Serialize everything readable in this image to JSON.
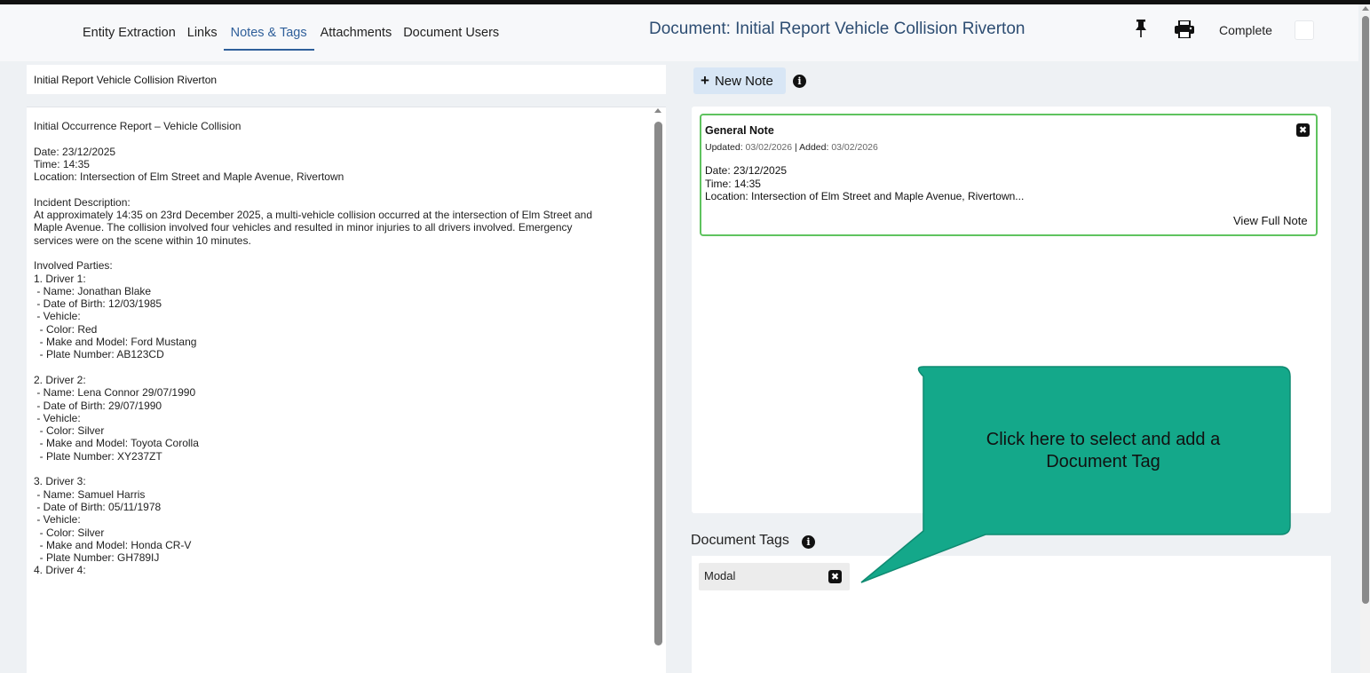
{
  "tabs": [
    {
      "label": "Entity Extraction"
    },
    {
      "label": "Links"
    },
    {
      "label": "Notes & Tags",
      "active": true
    },
    {
      "label": "Attachments"
    },
    {
      "label": "Document Users"
    }
  ],
  "header": {
    "doc_title": "Document: Initial Report Vehicle Collision Riverton",
    "complete_label": "Complete",
    "complete_checked": false,
    "pin_icon": "pin-icon",
    "print_icon": "print-icon"
  },
  "document": {
    "title_value": "Initial Report Vehicle Collision Riverton",
    "body": "Initial Occurrence Report – Vehicle Collision\n\nDate: 23/12/2025\nTime: 14:35\nLocation: Intersection of Elm Street and Maple Avenue, Rivertown\n\nIncident Description:\nAt approximately 14:35 on 23rd December 2025, a multi-vehicle collision occurred at the intersection of Elm Street and\nMaple Avenue. The collision involved four vehicles and resulted in minor injuries to all drivers involved. Emergency\nservices were on the scene within 10 minutes.\n\nInvolved Parties:\n1. Driver 1:\n - Name: Jonathan Blake\n - Date of Birth: 12/03/1985\n - Vehicle:\n  - Color: Red\n  - Make and Model: Ford Mustang\n  - Plate Number: AB123CD\n\n2. Driver 2:\n - Name: Lena Connor 29/07/1990\n - Date of Birth: 29/07/1990\n - Vehicle:\n  - Color: Silver\n  - Make and Model: Toyota Corolla\n  - Plate Number: XY237ZT\n\n3. Driver 3:\n - Name: Samuel Harris\n - Date of Birth: 05/11/1978\n - Vehicle:\n  - Color: Silver\n  - Make and Model: Honda CR-V\n  - Plate Number: GH789IJ\n4. Driver 4:"
  },
  "notes": {
    "new_note_label": "New Note",
    "items": [
      {
        "title": "General Note",
        "updated_label": "Updated:",
        "updated": "03/02/2026",
        "separator": "|",
        "added_label": "Added:",
        "added": "03/02/2026",
        "content": "Date: 23/12/2025\nTime: 14:35\nLocation: Intersection of Elm Street and Maple Avenue, Rivertown...",
        "view_full_label": "View Full Note"
      }
    ]
  },
  "tags": {
    "heading": "Document Tags",
    "items": [
      {
        "label": "Modal"
      }
    ]
  },
  "callout": {
    "text_line1": "Click here to select and add a",
    "text_line2": "Document Tag"
  },
  "colors": {
    "accent": "#2f5f9a",
    "note_border": "#5fc35f",
    "callout": "#14a88a"
  }
}
